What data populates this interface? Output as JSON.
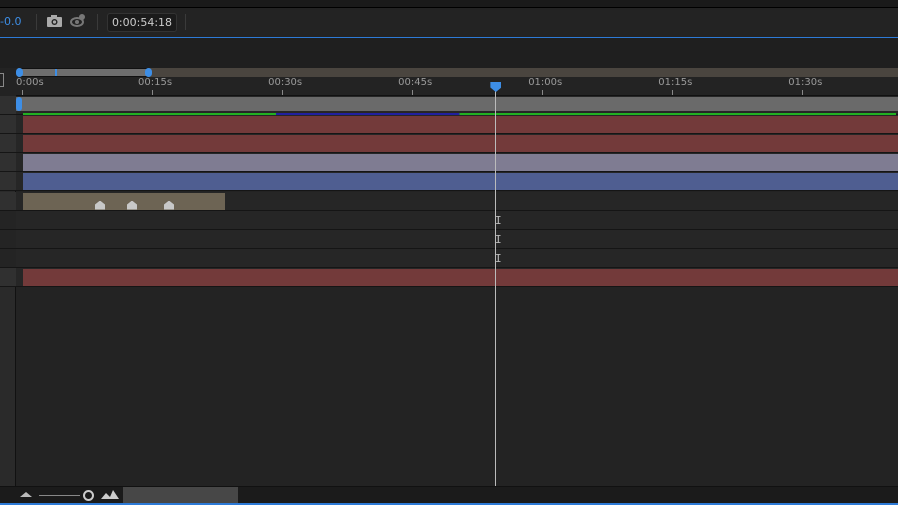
{
  "toolbar": {
    "zoom_value": "-0.0",
    "timecode": "0:00:54:18",
    "icons": [
      "camera-icon",
      "show-snapshot-icon"
    ]
  },
  "ruler": {
    "ticks": [
      "0:00s",
      "00:15s",
      "00:30s",
      "00:45s",
      "01:00s",
      "01:15s",
      "01:30s"
    ]
  },
  "playhead": {
    "time_seconds": 54.6
  },
  "layers": [
    {
      "type": "gray",
      "color": "#6a6a6a"
    },
    {
      "type": "red",
      "color": "#733a3a"
    },
    {
      "type": "red",
      "color": "#733a3a"
    },
    {
      "type": "lavender",
      "color": "#7f7c92"
    },
    {
      "type": "blue",
      "color": "#4f5e91"
    },
    {
      "type": "audio",
      "color": "#6d6454",
      "keyframes": 3
    },
    {
      "type": "empty"
    },
    {
      "type": "empty"
    },
    {
      "type": "empty"
    },
    {
      "type": "red",
      "color": "#733a3a"
    }
  ],
  "colors": {
    "accent": "#3d8ee6",
    "work_area_green": "#22b022",
    "work_area_blue": "#2020a0"
  }
}
